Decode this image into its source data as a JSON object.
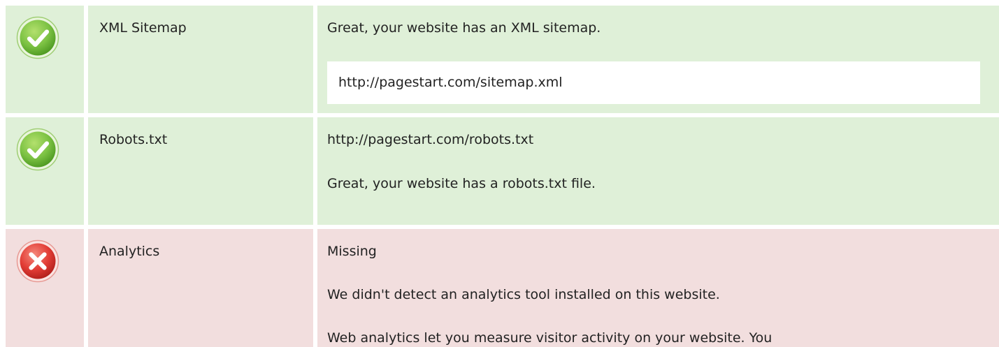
{
  "checks": [
    {
      "status": "pass",
      "label": "XML Sitemap",
      "message": "Great, your website has an XML sitemap.",
      "url": "http://pagestart.com/sitemap.xml"
    },
    {
      "status": "pass",
      "label": "Robots.txt",
      "url": "http://pagestart.com/robots.txt",
      "message": "Great, your website has a robots.txt file."
    },
    {
      "status": "fail",
      "label": "Analytics",
      "value": "Missing",
      "message": "We didn't detect an analytics tool installed on this website.",
      "description": "Web analytics let you measure visitor activity on your website. You"
    }
  ],
  "colors": {
    "pass_background": "#dff0d8",
    "fail_background": "#f2dede",
    "pass_icon": "#7cc243",
    "fail_icon": "#e23c35",
    "url_box": "#ffffff"
  },
  "icons": {
    "pass": "check-circle-icon",
    "fail": "x-circle-icon"
  }
}
